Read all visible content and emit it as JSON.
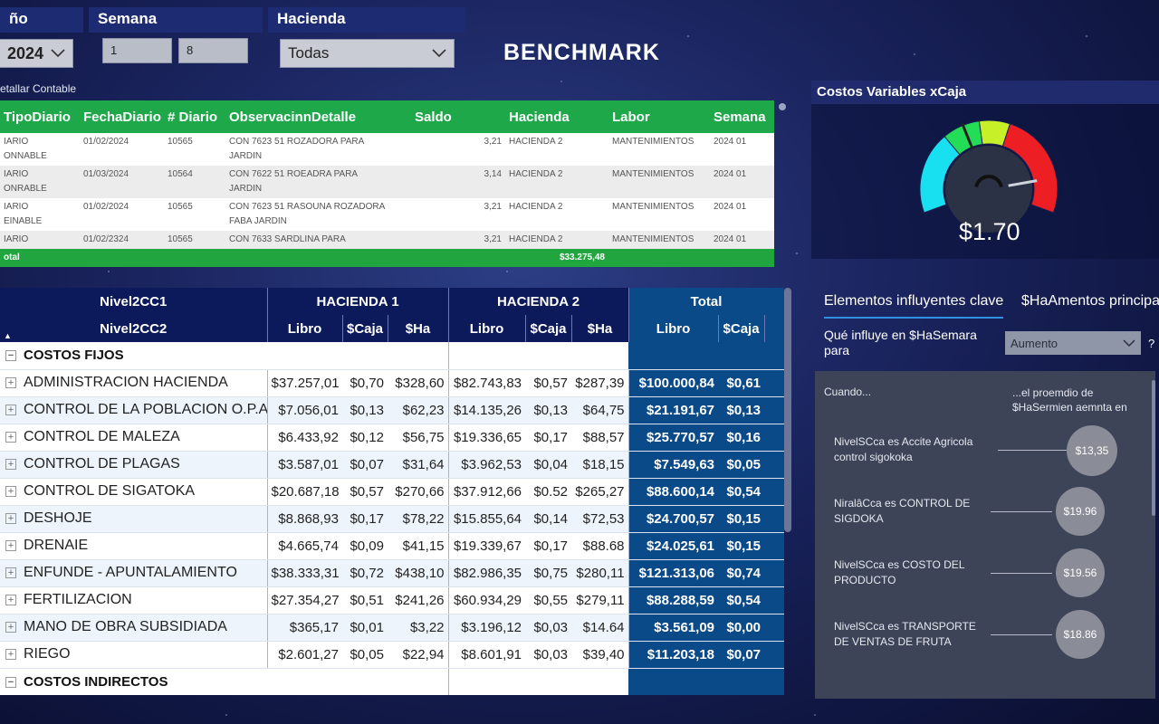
{
  "filters": {
    "year_label": "ño",
    "year_value": "2024",
    "week_label": "Semana",
    "week_from": "1",
    "week_to": "8",
    "hacienda_label": "Hacienda",
    "hacienda_value": "Todas"
  },
  "benchmark_title": "BENCHMARK",
  "journal": {
    "caption": "etallar Contable",
    "columns": [
      "TipoDiario",
      "FechaDiario",
      "# Diario",
      "ObservacinnDetalle",
      "Saldo",
      "Hacienda",
      "Labor",
      "Semana"
    ],
    "rows": [
      [
        "IARIO\nONNABLE",
        "01/02/2024",
        "10565",
        "CON  7623 51 ROZADORA PARA\nJARDIN",
        "3,21",
        "HACIENDA 2",
        "MANTENIMIENTOS",
        "2024 01"
      ],
      [
        "IARIO\nONRABLE",
        "01/03/2024",
        "10564",
        "CON  7622 51 ROEADRA PARA\nJARDIN",
        "3,14",
        "HACIENDA 2",
        "MANTENIMIENTOS",
        "2024 01"
      ],
      [
        "IARIO\nEINABLE",
        "01/02/2024",
        "10565",
        "CON  7623 51 RASOUNA ROZADORA\nFABA JARDIN",
        "3,21",
        "HACIENDA 2",
        "MANTENIMIENTOS",
        "2024 01"
      ],
      [
        "IARIO",
        "01/02/2324",
        "10565",
        "CON  7633 SARDLINA PARA",
        "3,21",
        "HACIENDA 2",
        "MANTENIMIENTOS",
        "2024 01"
      ]
    ],
    "total_label": "otal",
    "total_value": "$33.275,48"
  },
  "matrix": {
    "header1": {
      "level": "Nivel2CC1",
      "h1": "HACIENDA 1",
      "h2": "HACIENDA 2",
      "total": "Total"
    },
    "header2": {
      "level": "Nivel2CC2",
      "cols": [
        "Libro",
        "$Caja",
        "$Ha",
        "Libro",
        "$Caja",
        "$Ha",
        "Libro",
        "$Caja"
      ]
    },
    "group1": "COSTOS FIJOS",
    "group2": "COSTOS INDIRECTOS",
    "rows": [
      {
        "name": "ADMINISTRACION HACIENDA",
        "v": [
          "$37.257,01",
          "$0,70",
          "$328,60",
          "$82.743,83",
          "$0,57",
          "$287,39",
          "$100.000,84",
          "$0,61"
        ]
      },
      {
        "name": "CONTROL DE LA POBLACION O.P.A.",
        "v": [
          "$7.056,01",
          "$0,13",
          "$62,23",
          "$14.135,26",
          "$0,13",
          "$64,75",
          "$21.191,67",
          "$0,13"
        ]
      },
      {
        "name": "CONTROL DE MALEZA",
        "v": [
          "$6.433,92",
          "$0,12",
          "$56,75",
          "$19.336,65",
          "$0,17",
          "$88,57",
          "$25.770,57",
          "$0,16"
        ]
      },
      {
        "name": "CONTROL DE PLAGAS",
        "v": [
          "$3.587,01",
          "$0,07",
          "$31,64",
          "$3.962,53",
          "$0,04",
          "$18,15",
          "$7.549,63",
          "$0,05"
        ]
      },
      {
        "name": "CONTROL DE SIGATOKA",
        "v": [
          "$20.687,18",
          "$0,57",
          "$270,66",
          "$37.912,66",
          "$0.52",
          "$265,27",
          "$88.600,14",
          "$0,54"
        ]
      },
      {
        "name": "DESHOJE",
        "v": [
          "$8.868,93",
          "$0,17",
          "$78,22",
          "$15.855,64",
          "$0,14",
          "$72,53",
          "$24.700,57",
          "$0,15"
        ]
      },
      {
        "name": "DRENAIE",
        "v": [
          "$4.665,74",
          "$0,09",
          "$41,15",
          "$19.339,67",
          "$0,17",
          "$88.68",
          "$24.025,61",
          "$0,15"
        ]
      },
      {
        "name": "ENFUNDE - APUNTALAMIENTO",
        "v": [
          "$38.333,31",
          "$0,72",
          "$438,10",
          "$82.986,35",
          "$0,75",
          "$280,11",
          "$121.313,06",
          "$0,74"
        ]
      },
      {
        "name": "FERTILIZACION",
        "v": [
          "$27.354,27",
          "$0,51",
          "$241,26",
          "$60.934,29",
          "$0,55",
          "$279,11",
          "$88.288,59",
          "$0,54"
        ]
      },
      {
        "name": "MANO DE OBRA SUBSIDIADA",
        "v": [
          "$365,17",
          "$0,01",
          "$3,22",
          "$3.196,12",
          "$0,03",
          "$14.64",
          "$3.561,09",
          "$0,00"
        ]
      },
      {
        "name": "RIEGO",
        "v": [
          "$2.601,27",
          "$0,05",
          "$22,94",
          "$8.601,91",
          "$0,03",
          "$39,40",
          "$11.203,18",
          "$0,07"
        ]
      }
    ]
  },
  "gauge": {
    "title": "Costos Variables xCaja",
    "value": 1.7,
    "value_label": "$1.70",
    "colors": [
      "#19e0f0",
      "#22dd55",
      "#c8f028",
      "#ee1f24"
    ]
  },
  "key_influencers": {
    "tab_active": "Elementos influyentes clave",
    "tab_other": "$HaAmentos principa",
    "question": "Qué influye en $HaSemara\npara",
    "select_value": "Aumento",
    "help": "?",
    "cuando": "Cuando...",
    "promedio": "...el proemdio de\n$HaSermien aemnta en",
    "items": [
      {
        "text": "NivelSCca es Accite Agricola\ncontrol sigokoka",
        "value": "$13,35"
      },
      {
        "text": "NiralâCca es CONTROL DE\nSIGDOKA",
        "value": "$19.96"
      },
      {
        "text": "NivelSCca es COSTO DEL\nPRODUCTO",
        "value": "$19.56"
      },
      {
        "text": "NivelSCca es TRANSPORTE\nDE VENTAS DE FRUTA",
        "value": "$18.86"
      }
    ]
  }
}
